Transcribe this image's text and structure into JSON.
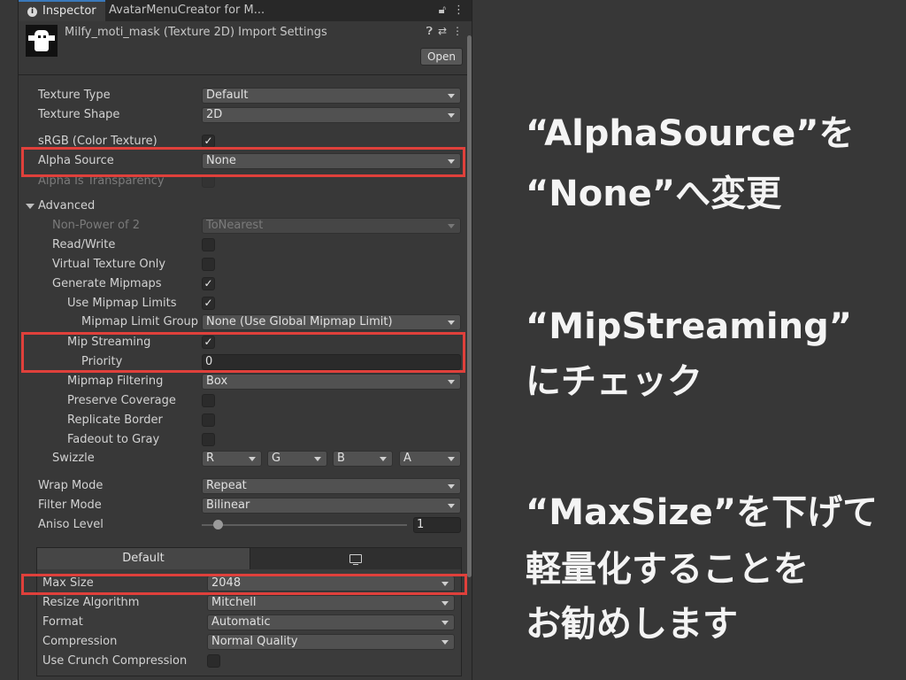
{
  "tabs": {
    "inspector": "Inspector",
    "other": "AvatarMenuCreator for M...",
    "lock_icon": "lock-icon",
    "more_icon": "kebab-menu-icon"
  },
  "header": {
    "title": "Milfy_moti_mask (Texture 2D) Import Settings",
    "help_icon": "help-icon",
    "settings_icon": "settings-sliders-icon",
    "open_button": "Open"
  },
  "settings": {
    "texture_type": {
      "label": "Texture Type",
      "value": "Default"
    },
    "texture_shape": {
      "label": "Texture Shape",
      "value": "2D"
    },
    "srgb": {
      "label": "sRGB (Color Texture)",
      "checked": true
    },
    "alpha_source": {
      "label": "Alpha Source",
      "value": "None"
    },
    "alpha_transparency": {
      "label": "Alpha Is Transparency",
      "checked": false
    },
    "advanced": {
      "label": "Advanced"
    },
    "npot": {
      "label": "Non-Power of 2",
      "value": "ToNearest"
    },
    "read_write": {
      "label": "Read/Write",
      "checked": false
    },
    "virtual_texture": {
      "label": "Virtual Texture Only",
      "checked": false
    },
    "generate_mipmaps": {
      "label": "Generate Mipmaps",
      "checked": true
    },
    "use_mipmap_limits": {
      "label": "Use Mipmap Limits",
      "checked": true
    },
    "mipmap_limit_group": {
      "label": "Mipmap Limit Group",
      "value": "None (Use Global Mipmap Limit)"
    },
    "mip_streaming": {
      "label": "Mip Streaming",
      "checked": true
    },
    "priority": {
      "label": "Priority",
      "value": "0"
    },
    "mipmap_filtering": {
      "label": "Mipmap Filtering",
      "value": "Box"
    },
    "preserve_coverage": {
      "label": "Preserve Coverage",
      "checked": false
    },
    "replicate_border": {
      "label": "Replicate Border",
      "checked": false
    },
    "fadeout_gray": {
      "label": "Fadeout to Gray",
      "checked": false
    },
    "swizzle": {
      "label": "Swizzle",
      "r": "R",
      "g": "G",
      "b": "B",
      "a": "A"
    },
    "wrap_mode": {
      "label": "Wrap Mode",
      "value": "Repeat"
    },
    "filter_mode": {
      "label": "Filter Mode",
      "value": "Bilinear"
    },
    "aniso_level": {
      "label": "Aniso Level",
      "value": "1"
    }
  },
  "platform": {
    "default_tab": "Default",
    "standalone_icon": "monitor-icon",
    "max_size": {
      "label": "Max Size",
      "value": "2048"
    },
    "resize_algorithm": {
      "label": "Resize Algorithm",
      "value": "Mitchell"
    },
    "format": {
      "label": "Format",
      "value": "Automatic"
    },
    "compression": {
      "label": "Compression",
      "value": "Normal Quality"
    },
    "crunch": {
      "label": "Use Crunch Compression",
      "checked": false
    }
  },
  "notes": {
    "alpha_line1": "“AlphaSource”を",
    "alpha_line2": "“None”へ変更",
    "mip_line1": "“MipStreaming”",
    "mip_line2": "にチェック",
    "max_line1": "“MaxSize”を下げて",
    "max_line2": "軽量化することを",
    "max_line3": "お勧めします"
  },
  "colors": {
    "highlight": "#e0403b",
    "panel": "#383838",
    "background": "#373737"
  }
}
